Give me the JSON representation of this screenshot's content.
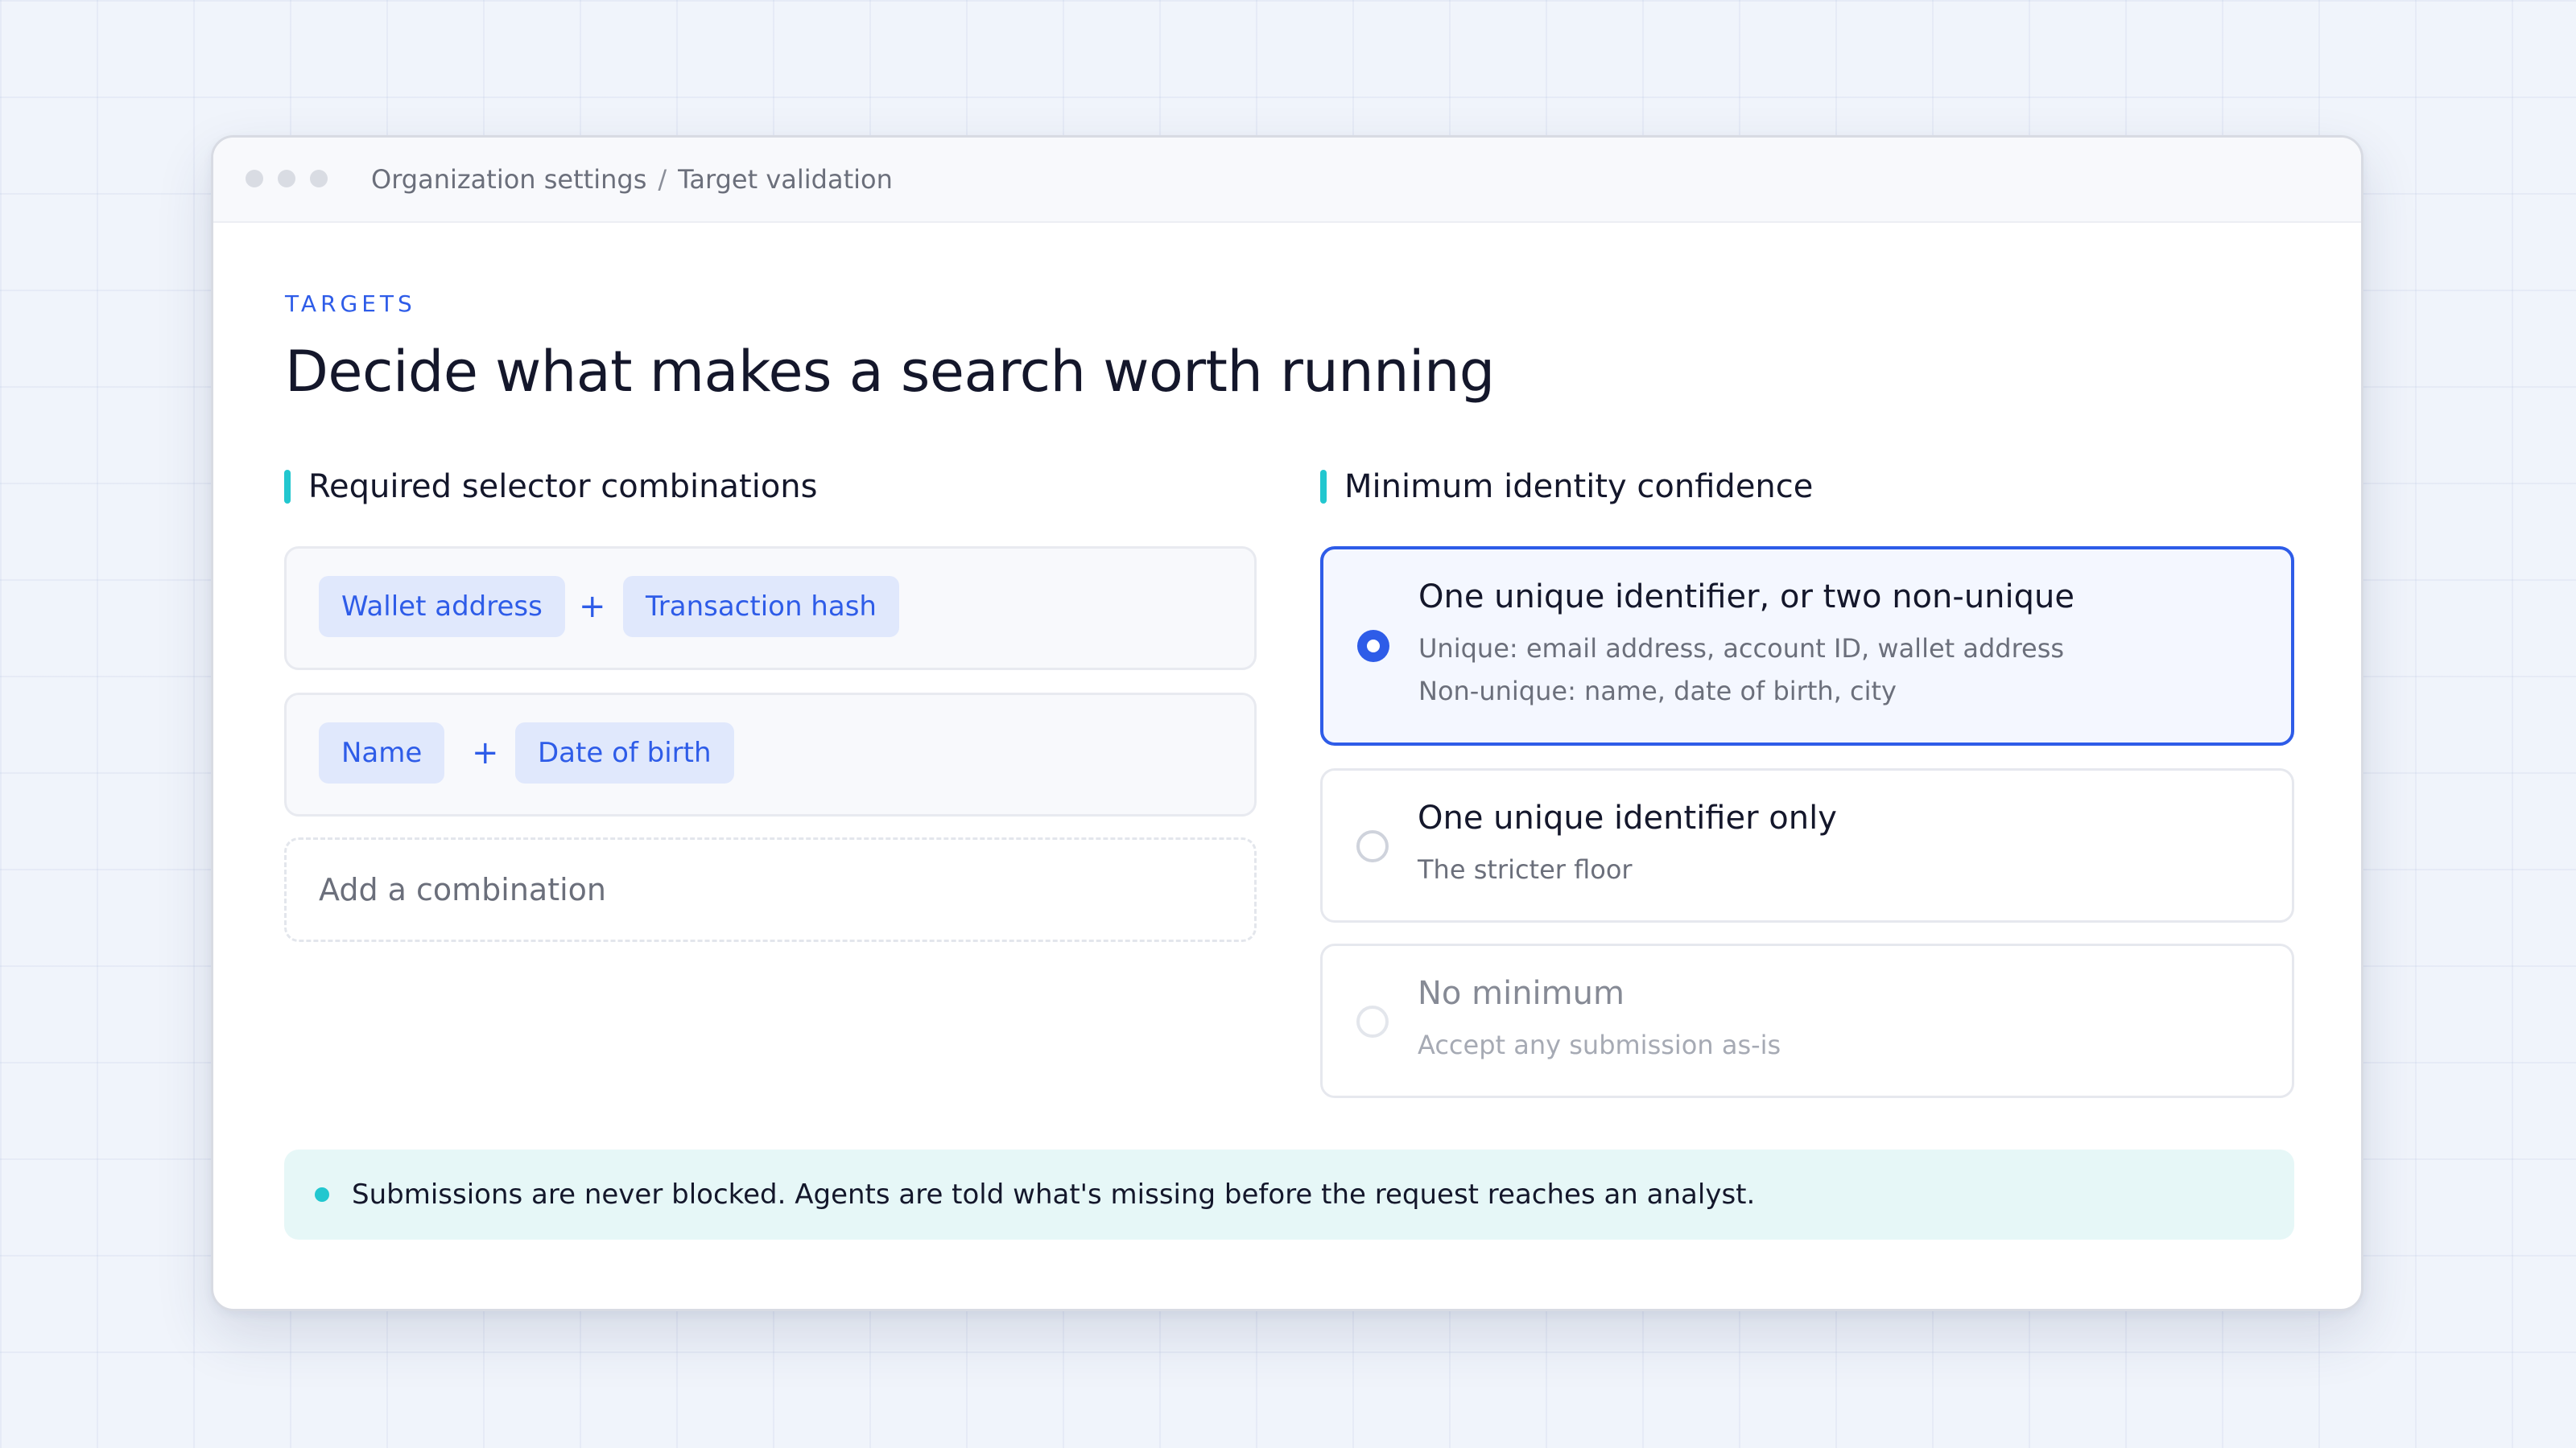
{
  "window": {
    "breadcrumb": {
      "parent": "Organization settings",
      "separator": "/",
      "current": "Target validation"
    }
  },
  "page": {
    "eyebrow": "TARGETS",
    "title": "Decide what makes a search worth running"
  },
  "combinations": {
    "heading": "Required selector combinations",
    "items": [
      {
        "selectors": [
          "Wallet address",
          "Transaction hash"
        ],
        "joiner": "+"
      },
      {
        "selectors": [
          "Name",
          "Date of birth"
        ],
        "joiner": "+"
      }
    ],
    "add_placeholder": "Add a combination"
  },
  "confidence": {
    "heading": "Minimum identity confidence",
    "selected_index": 0,
    "options": [
      {
        "title": "One unique identifier, or two non-unique",
        "lines": [
          "Unique: email address, account ID, wallet address",
          "Non-unique: name, date of birth, city"
        ]
      },
      {
        "title": "One unique identifier only",
        "lines": [
          "The stricter floor"
        ]
      },
      {
        "title": "No minimum",
        "lines": [
          "Accept any submission as-is"
        ]
      }
    ]
  },
  "notice": {
    "text": "Submissions are never blocked. Agents are told what's missing before the request reaches an analyst."
  },
  "colors": {
    "accent": "#2e5ce8",
    "teal": "#22c7cf",
    "chip_bg": "#e0e8fc",
    "notice_bg": "#e6f7f7"
  }
}
